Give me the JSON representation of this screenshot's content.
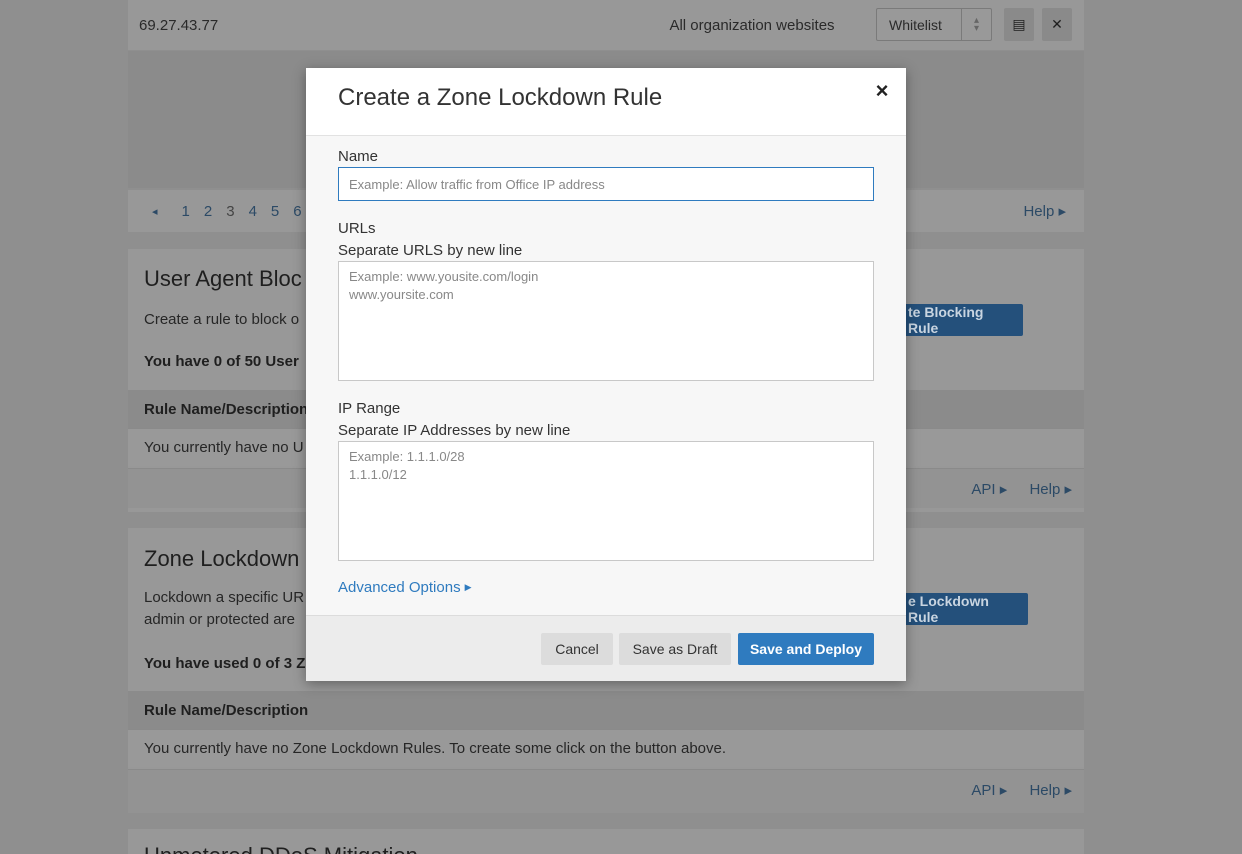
{
  "background": {
    "rule_row": {
      "ip": "69.27.43.77",
      "scope": "All organization websites",
      "mode_select": "Whitelist"
    },
    "pager": {
      "prev": "◂",
      "pages": [
        "1",
        "2",
        "3",
        "4",
        "5",
        "6"
      ],
      "help": "Help ▸"
    },
    "ua_section": {
      "title": "User Agent Bloc",
      "desc": "Create a rule to block o",
      "count": "You have 0 of 50 User",
      "button": "te Blocking Rule",
      "table_head": "Rule Name/Description",
      "empty_row": "You currently have no U",
      "api": "API ▸",
      "help": "Help ▸"
    },
    "zl_section": {
      "title": "Zone Lockdown",
      "desc_line1": "Lockdown a specific UR",
      "desc_line2": "admin or protected are",
      "count": "You have used 0 of 3 Z",
      "button": "e Lockdown Rule",
      "table_head": "Rule Name/Description",
      "empty_row": "You currently have no Zone Lockdown Rules. To create some click on the button above.",
      "api": "API ▸",
      "help": "Help ▸"
    },
    "next_section_title": "Unmetered DDoS Mitigation"
  },
  "modal": {
    "title": "Create a Zone Lockdown Rule",
    "close": "×",
    "name": {
      "label": "Name",
      "placeholder": "Example: Allow traffic from Office IP address"
    },
    "urls": {
      "label": "URLs",
      "sublabel": "Separate URLS by new line",
      "placeholder": "Example: www.yousite.com/login\nwww.yoursite.com"
    },
    "ip_range": {
      "label": "IP Range",
      "sublabel": "Separate IP Addresses by new line",
      "placeholder": "Example: 1.1.1.0/28\n1.1.1.0/12"
    },
    "advanced": "Advanced Options",
    "buttons": {
      "cancel": "Cancel",
      "draft": "Save as Draft",
      "deploy": "Save and Deploy"
    }
  }
}
